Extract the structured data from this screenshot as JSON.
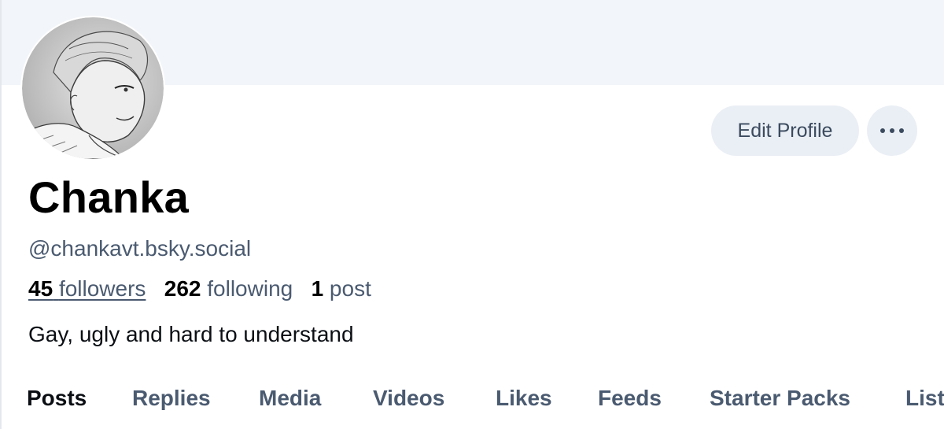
{
  "profile": {
    "display_name": "Chanka",
    "handle": "@chankavt.bsky.social",
    "followers_count": "45",
    "followers_label": "followers",
    "following_count": "262",
    "following_label": "following",
    "posts_count": "1",
    "posts_label": "post",
    "bio": "Gay, ugly and hard to understand",
    "avatar_icon": "anime-portrait-avatar"
  },
  "actions": {
    "edit_profile_label": "Edit Profile",
    "more_icon": "ellipsis-icon"
  },
  "tabs": [
    {
      "label": "Posts",
      "active": true
    },
    {
      "label": "Replies",
      "active": false
    },
    {
      "label": "Media",
      "active": false
    },
    {
      "label": "Videos",
      "active": false
    },
    {
      "label": "Likes",
      "active": false
    },
    {
      "label": "Feeds",
      "active": false
    },
    {
      "label": "Starter Packs",
      "active": false
    },
    {
      "label": "Lists",
      "active": false
    }
  ],
  "colors": {
    "banner": "#f2f5f9",
    "button_bg": "#eaeff5",
    "muted_text": "#4a5a70",
    "primary_text": "#0b0f14"
  }
}
